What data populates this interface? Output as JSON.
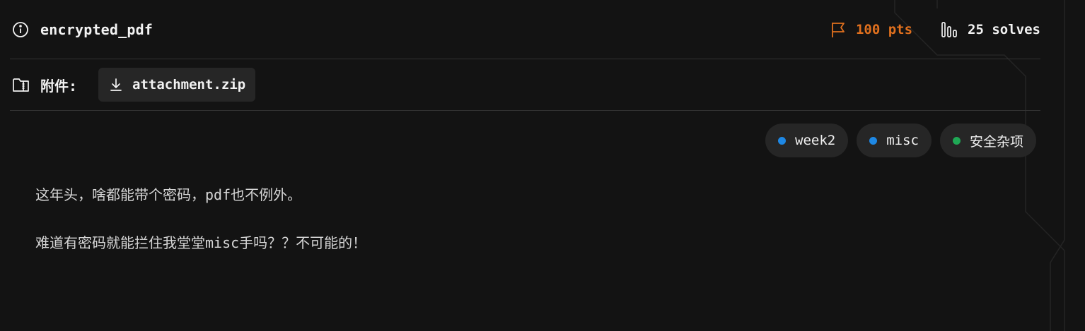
{
  "challenge": {
    "title": "encrypted_pdf",
    "points": "100 pts",
    "solves": "25 solves"
  },
  "attachment": {
    "label": "附件:",
    "file_name": "attachment.zip"
  },
  "tags": [
    {
      "label": "week2",
      "color": "#1e88e5"
    },
    {
      "label": "misc",
      "color": "#1e88e5"
    },
    {
      "label": "安全杂项",
      "color": "#1fa855"
    }
  ],
  "description": {
    "line1": "这年头，啥都能带个密码，pdf也不例外。",
    "line2": "难道有密码就能拦住我堂堂misc手吗？？不可能的！"
  },
  "colors": {
    "background": "#131313",
    "points": "#e0701e",
    "tag_bg": "#262626",
    "divider": "#333333"
  },
  "icons": {
    "info": "info-circle-icon",
    "flag": "flag-icon",
    "solves": "bar-chart-icon",
    "folder": "folder-zip-icon",
    "download": "download-arrow-icon"
  }
}
